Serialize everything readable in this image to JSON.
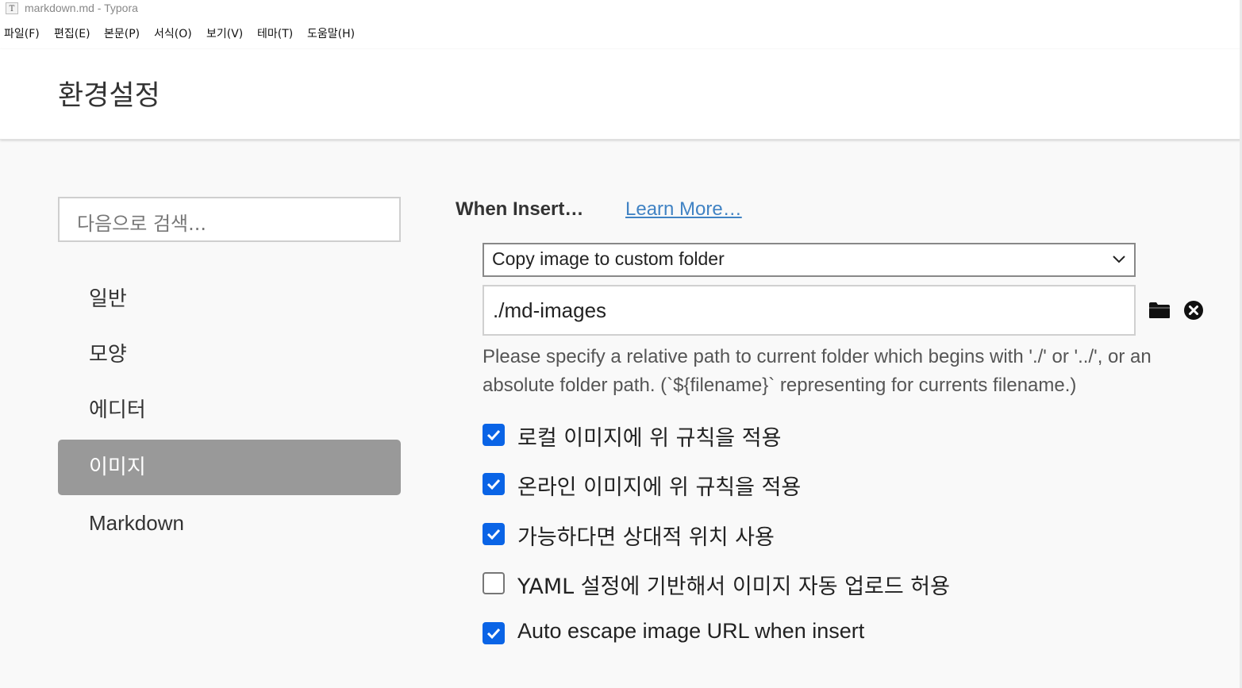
{
  "window": {
    "icon_letter": "T",
    "title": "markdown.md - Typora"
  },
  "menubar": {
    "items": [
      "파일(F)",
      "편집(E)",
      "본문(P)",
      "서식(O)",
      "보기(V)",
      "테마(T)",
      "도움말(H)"
    ]
  },
  "header": {
    "title": "환경설정"
  },
  "sidebar": {
    "search_placeholder": "다음으로 검색...",
    "items": [
      {
        "label": "일반",
        "active": false
      },
      {
        "label": "모양",
        "active": false
      },
      {
        "label": "에디터",
        "active": false
      },
      {
        "label": "이미지",
        "active": true
      },
      {
        "label": "Markdown",
        "active": false
      }
    ]
  },
  "image_settings": {
    "section_label": "When Insert…",
    "learn_more": "Learn More…",
    "insert_action": "Copy image to custom folder",
    "folder_path": "./md-images",
    "hint": " Please specify a relative path to current folder which begins with './' or '../', or an absolute folder path. (`${filename}` representing for currents filename.)",
    "options": [
      {
        "label": "로컬 이미지에 위 규칙을 적용",
        "checked": true
      },
      {
        "label": "온라인 이미지에 위 규칙을 적용",
        "checked": true
      },
      {
        "label": "가능하다면 상대적 위치 사용",
        "checked": true
      },
      {
        "label": "YAML 설정에 기반해서 이미지 자동 업로드 허용",
        "checked": false
      },
      {
        "label": "Auto escape image URL when insert",
        "checked": true
      }
    ]
  },
  "colors": {
    "accent": "#0a64e6",
    "link": "#4183c4",
    "active_nav": "#999999"
  }
}
